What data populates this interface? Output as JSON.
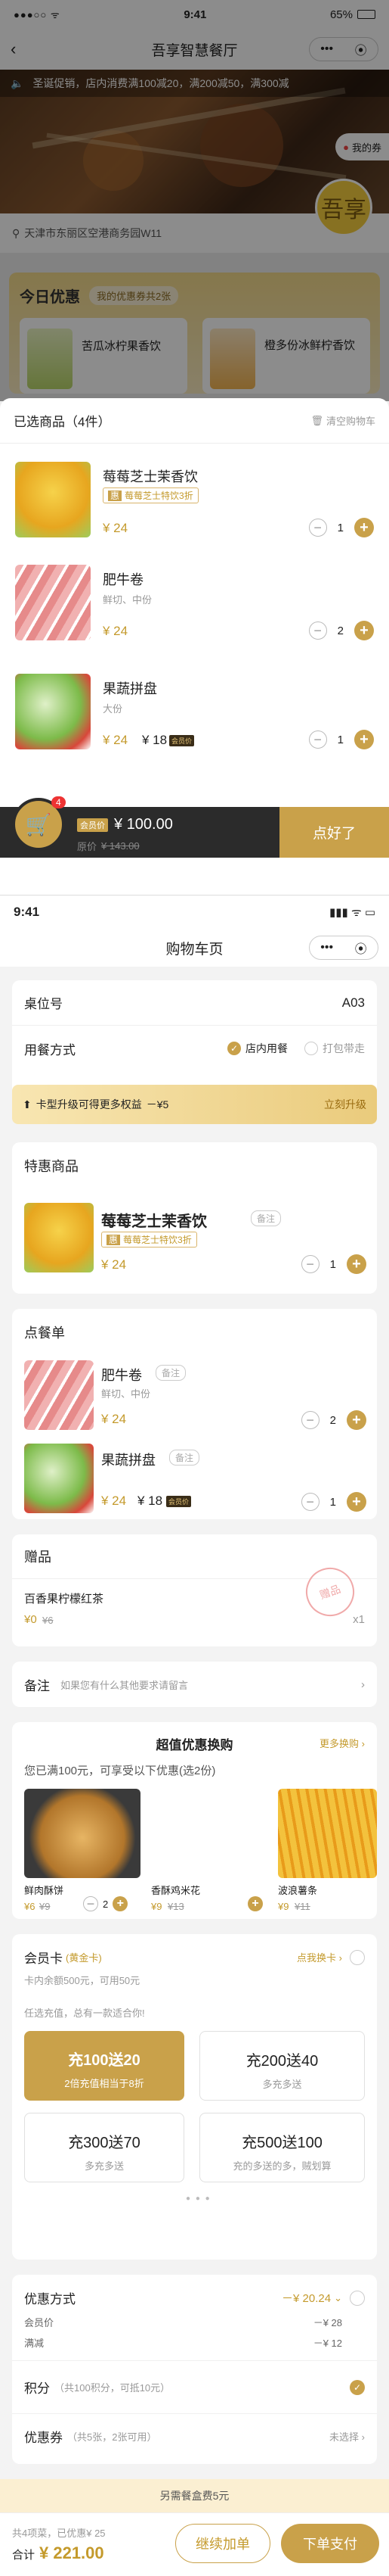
{
  "p1": {
    "status": {
      "time": "9:41",
      "battery": "65%"
    },
    "title": "吾享智慧餐厅",
    "marquee": "圣诞促销，店内消费满100减20，满200减50，满300减",
    "my_coupon": "我的券",
    "address": "天津市东丽区空港商务园W11",
    "today": {
      "title": "今日优惠",
      "tag": "我的优惠券共2张",
      "items": [
        "苦瓜冰柠果香饮",
        "橙多份冰鲜柠香饮"
      ]
    },
    "cart": {
      "title": "已选商品（4件）",
      "clear": "清空购物车",
      "items": [
        {
          "name": "莓莓芝士茉香饮",
          "tag": "莓莓芝士特饮3折",
          "price": "¥ 24",
          "qty": "1"
        },
        {
          "name": "肥牛卷",
          "spec": "鲜切、中份",
          "price": "¥ 24",
          "qty": "2"
        },
        {
          "name": "果蔬拼盘",
          "spec": "大份",
          "price": "¥ 24",
          "member_price": "¥ 18",
          "member_tag": "会员价",
          "qty": "1"
        }
      ]
    },
    "bottom": {
      "badge": "4",
      "member_label": "会员价",
      "total": "¥ 100.00",
      "orig_label": "原价",
      "orig": "¥ 143.00",
      "submit": "点好了"
    }
  },
  "p2": {
    "status": {
      "time": "9:41"
    },
    "title": "购物车页",
    "table": {
      "label": "桌位号",
      "value": "A03"
    },
    "dining": {
      "label": "用餐方式",
      "opt1": "店内用餐",
      "opt2": "打包带走"
    },
    "upgrade": {
      "text": "卡型升级可得更多权益",
      "discount": "－¥5",
      "action": "立刻升级"
    },
    "special": {
      "title": "特惠商品",
      "name": "莓莓芝士茉香饮",
      "note": "备注",
      "tag": "莓莓芝士特饮3折",
      "price": "¥ 24",
      "qty": "1"
    },
    "order": {
      "title": "点餐单",
      "items": [
        {
          "name": "肥牛卷",
          "note": "备注",
          "spec": "鲜切、中份",
          "price": "¥ 24",
          "qty": "2"
        },
        {
          "name": "果蔬拼盘",
          "note": "备注",
          "price": "¥ 24",
          "member_price": "¥ 18",
          "member_tag": "会员价",
          "qty": "1"
        }
      ]
    },
    "gift": {
      "title": "赠品",
      "name": "百香果柠檬红茶",
      "price": "¥0",
      "orig": "¥6",
      "qty": "x1",
      "stamp": "赠品"
    },
    "remark": {
      "label": "备注",
      "placeholder": "如果您有什么其他要求请留言"
    },
    "deals": {
      "title": "超值优惠换购",
      "more": "更多换购",
      "sub": "您已满100元，可享受以下优惠(选2份)",
      "items": [
        {
          "name": "鲜肉酥饼",
          "price": "¥6",
          "orig": "¥9",
          "qty": "2"
        },
        {
          "name": "香酥鸡米花",
          "price": "¥9",
          "orig": "¥13"
        },
        {
          "name": "波浪薯条",
          "price": "¥9",
          "orig": "¥11"
        }
      ]
    },
    "member": {
      "title": "会员卡",
      "tag": "(黄金卡)",
      "balance": "卡内余额500元，可用50元",
      "action": "点我换卡",
      "hint": "任选充值，总有一款适合你!",
      "opts": [
        {
          "t": "充100送20",
          "s": "2倍充值相当于8折"
        },
        {
          "t": "充200送40",
          "s": "多充多送"
        },
        {
          "t": "充300送70",
          "s": "多充多送"
        },
        {
          "t": "充500送100",
          "s": "充的多送的多，贼划算"
        }
      ]
    },
    "discount": {
      "title": "优惠方式",
      "value": "－¥ 20.24",
      "rows": [
        {
          "l": "会员价",
          "v": "－¥ 28"
        },
        {
          "l": "满减",
          "v": "－¥ 12"
        }
      ]
    },
    "points": {
      "label": "积分",
      "detail": "（共100积分，可抵10元）"
    },
    "coupon": {
      "label": "优惠券",
      "detail": "（共5张，2张可用）",
      "action": "未选择"
    },
    "packing": "另需餐盒费5元",
    "bottom": {
      "summary": "共4项菜，已优惠¥ 25",
      "total_label": "合计",
      "total": "¥ 221.00",
      "btn1": "继续加单",
      "btn2": "下单支付"
    }
  }
}
